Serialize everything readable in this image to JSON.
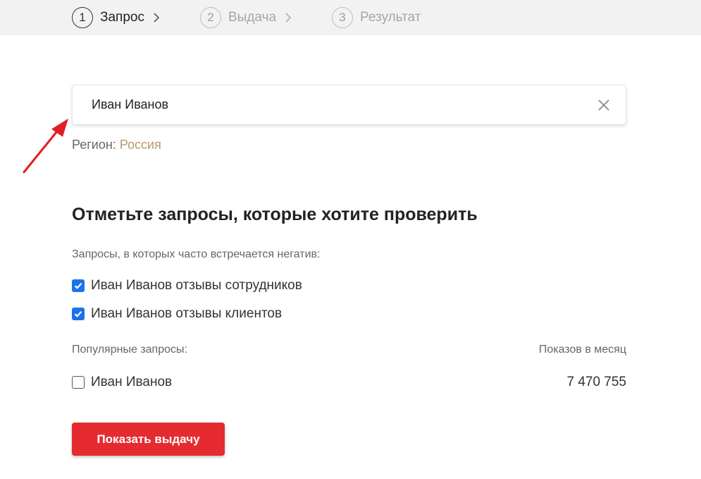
{
  "stepper": {
    "steps": [
      {
        "number": "1",
        "label": "Запрос",
        "active": true
      },
      {
        "number": "2",
        "label": "Выдача",
        "active": false
      },
      {
        "number": "3",
        "label": "Результат",
        "active": false
      }
    ]
  },
  "search": {
    "value": "Иван Иванов"
  },
  "region": {
    "label": "Регион:",
    "value": "Россия"
  },
  "heading": "Отметьте запросы, которые хотите проверить",
  "negative": {
    "title": "Запросы, в которых часто встречается негатив:",
    "items": [
      {
        "label": "Иван Иванов отзывы сотрудников",
        "checked": true
      },
      {
        "label": "Иван Иванов отзывы клиентов",
        "checked": true
      }
    ]
  },
  "popular": {
    "title": "Популярные запросы:",
    "shows_header": "Показов в месяц",
    "items": [
      {
        "label": "Иван Иванов",
        "checked": false,
        "shows": "7 470 755"
      }
    ]
  },
  "actions": {
    "show_results_label": "Показать выдачу"
  },
  "colors": {
    "accent_red": "#e52b2f",
    "checkbox_blue": "#1a73e8",
    "region_gold": "#b79a64",
    "stepper_bg": "#f2f2f2"
  }
}
